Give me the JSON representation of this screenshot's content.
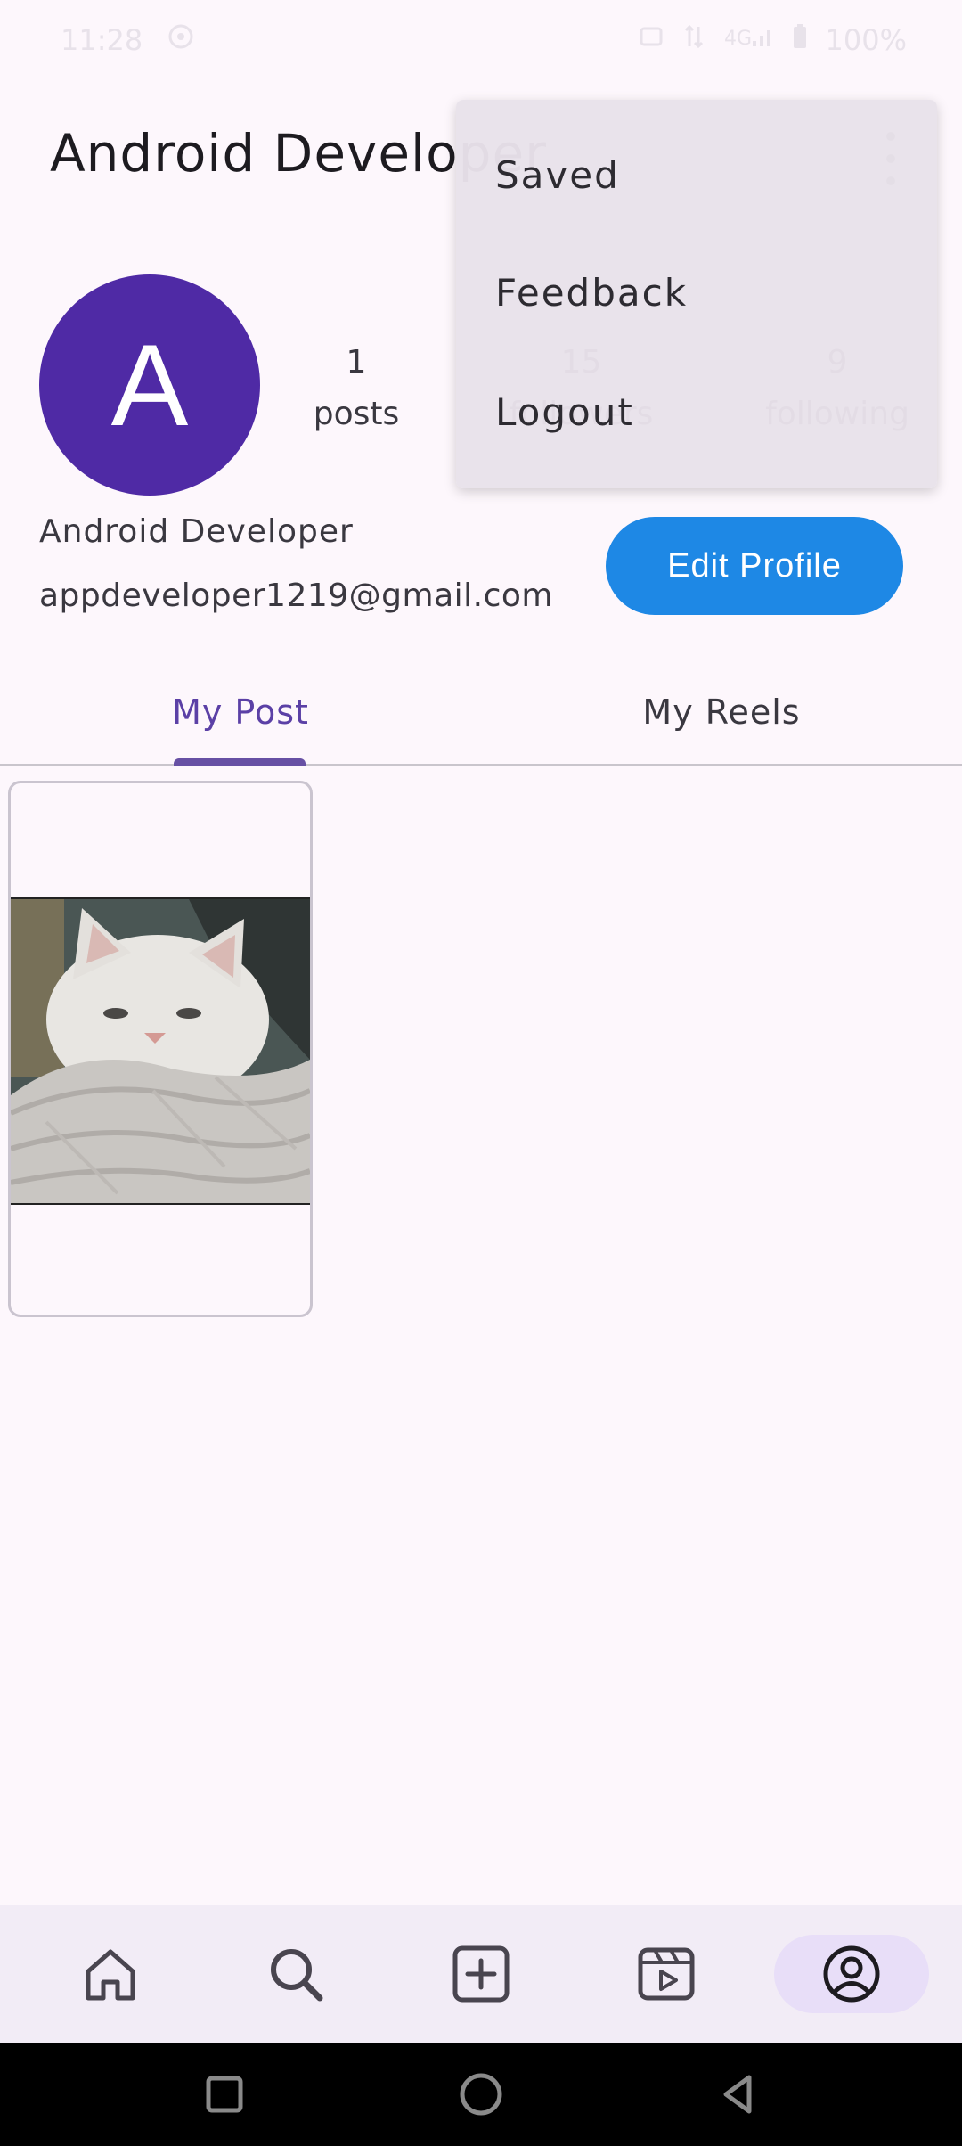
{
  "status_bar": {
    "time": "11:28",
    "battery": "100%"
  },
  "header": {
    "title": "Android Developer"
  },
  "profile": {
    "avatar_letter": "A",
    "name": "Android Developer",
    "email": "appdeveloper1219@gmail.com",
    "posts_count": "1",
    "posts_label": "posts",
    "followers_count": "15",
    "followers_label": "followers",
    "following_count": "9",
    "following_label": "following",
    "edit_button": "Edit Profile"
  },
  "tabs": [
    {
      "label": "My Post",
      "active": true
    },
    {
      "label": "My Reels",
      "active": false
    }
  ],
  "menu": {
    "items": [
      "Saved",
      "Feedback",
      "Logout"
    ]
  },
  "bottom_nav": {
    "items": [
      "home-icon",
      "search-icon",
      "add-post-icon",
      "reels-icon",
      "profile-icon"
    ],
    "active": "profile-icon"
  },
  "colors": {
    "accent": "#6750a4",
    "avatar": "#4f2aa5",
    "edit_button": "#1e88e5",
    "background": "#fdf7fc"
  }
}
